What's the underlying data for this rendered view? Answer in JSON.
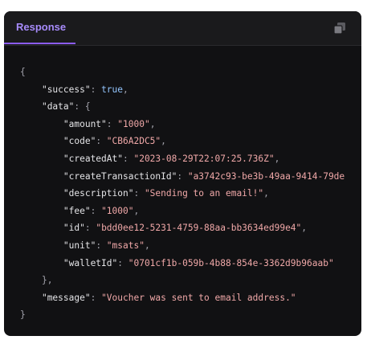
{
  "panel": {
    "tab_label": "Response",
    "copy_icon": "copy-icon"
  },
  "json": {
    "open_brace": "{",
    "success_key": "\"success\"",
    "success_value": "true",
    "data_key": "\"data\"",
    "data_open": "{",
    "fields": [
      {
        "key": "\"amount\"",
        "value": "\"1000\""
      },
      {
        "key": "\"code\"",
        "value": "\"CB6A2DC5\""
      },
      {
        "key": "\"createdAt\"",
        "value": "\"2023-08-29T22:07:25.736Z\""
      },
      {
        "key": "\"createTransactionId\"",
        "value": "\"a3742c93-be3b-49aa-9414-79de"
      },
      {
        "key": "\"description\"",
        "value": "\"Sending to an email!\""
      },
      {
        "key": "\"fee\"",
        "value": "\"1000\""
      },
      {
        "key": "\"id\"",
        "value": "\"bdd0ee12-5231-4759-88aa-bb3634ed99e4\""
      },
      {
        "key": "\"unit\"",
        "value": "\"msats\""
      },
      {
        "key": "\"walletId\"",
        "value": "\"0701cf1b-059b-4b88-854e-3362d9b96aab\""
      }
    ],
    "data_close": "},",
    "message_key": "\"message\"",
    "message_value": "\"Voucher was sent to email address.\"",
    "close_brace": "}"
  }
}
